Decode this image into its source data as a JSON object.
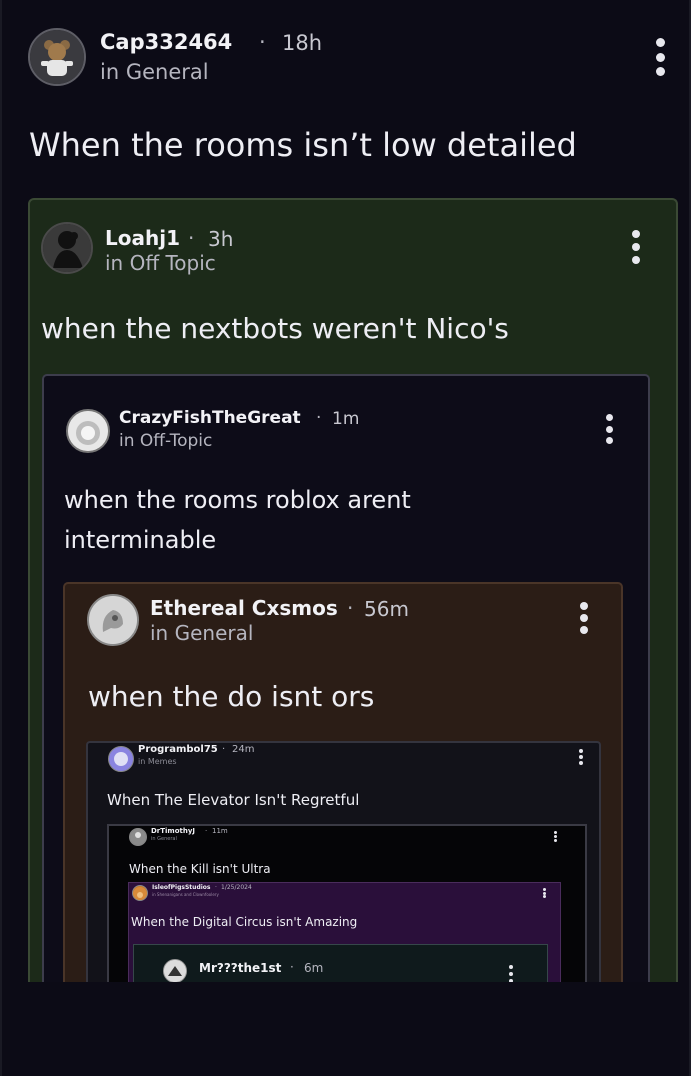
{
  "post": {
    "author": "Cap332464",
    "time": "18h",
    "community": "in General",
    "text": "When the rooms isn’t low detailed",
    "colors": {
      "background": "#0c0b16"
    }
  },
  "quotes": [
    {
      "author": "Loahj1",
      "time": "3h",
      "community": "in Off Topic",
      "text": "when the nextbots weren't Nico's",
      "color": "#1c2a19"
    },
    {
      "author": "CrazyFishTheGreat",
      "time": "1m",
      "community": "in Off-Topic",
      "text_line1": "when the rooms roblox arent",
      "text_line2": "interminable",
      "color": "#0d0c18"
    },
    {
      "author": "Ethereal Cxsmos",
      "time": "56m",
      "community": "in General",
      "text": "when the do isnt ors",
      "color": "#2b1d16"
    },
    {
      "author": "Programbol75",
      "time": "24m",
      "community": "in Memes",
      "text": "When The Elevator Isn't Regretful",
      "color": "#121219"
    },
    {
      "author": "DrTimothyJ",
      "time": "11m",
      "community": "in General",
      "text": "When the Kill isn't Ultra",
      "color": "#050507"
    },
    {
      "author": "IsleofPigsStudios",
      "time": "1/25/2024",
      "community": "in Shenanigans and Clownfoolery",
      "text": "When the Digital Circus isn't Amazing",
      "color": "#2a0f3a"
    },
    {
      "author": "Mr???the1st",
      "time": "6m",
      "community": "",
      "text": "",
      "color": "#0f1a1c"
    }
  ],
  "separator": "·",
  "icons": {
    "menu": "vertical-ellipsis-icon",
    "avatar": "avatar-icon"
  }
}
